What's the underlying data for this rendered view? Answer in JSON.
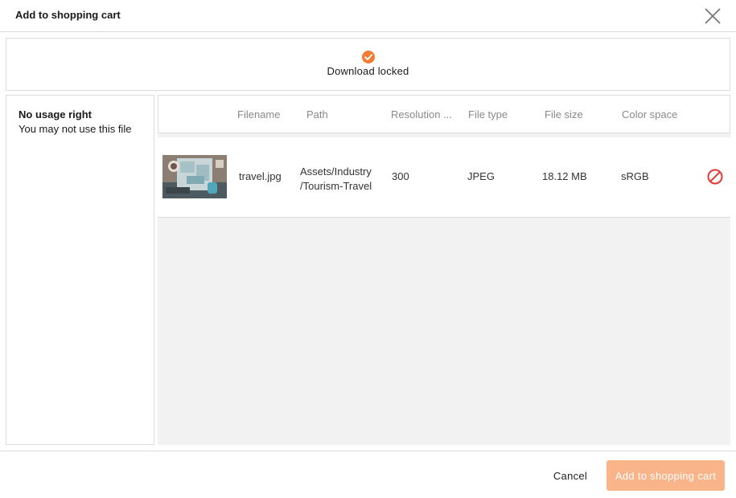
{
  "dialog": {
    "title": "Add to shopping cart",
    "close_icon": "close-icon"
  },
  "notice": {
    "icon": "check-circle-icon",
    "icon_color": "#f47c30",
    "text": "Download locked"
  },
  "usage": {
    "title": "No usage right",
    "subtitle": "You may not use this file"
  },
  "table": {
    "columns": [
      "Filename",
      "Path",
      "Resolution ...",
      "File type",
      "File size",
      "Color space"
    ],
    "rows": [
      {
        "thumbnail": "travel-photo-thumbnail",
        "filename": "travel.jpg",
        "path_line1": "Assets/Industry",
        "path_line2": "/Tourism-Travel",
        "resolution": "300",
        "file_type": "JPEG",
        "file_size": "18.12 MB",
        "color_space": "sRGB",
        "status_icon": "blocked-icon",
        "status_color": "#e53935"
      }
    ]
  },
  "footer": {
    "cancel_label": "Cancel",
    "add_label": "Add to shopping cart",
    "add_color": "#f9b48a"
  }
}
